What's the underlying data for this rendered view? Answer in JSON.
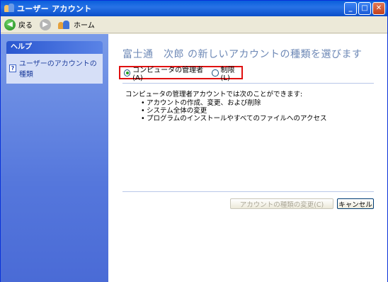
{
  "window": {
    "title": "ユーザー アカウント",
    "buttons": {
      "minimize": "_",
      "maximize": "□",
      "close": "✕"
    }
  },
  "toolbar": {
    "back_label": "戻る",
    "back_icon": "back-arrow-icon",
    "forward_icon": "forward-arrow-icon",
    "home_label": "ホーム",
    "home_icon": "users-icon"
  },
  "sidebar": {
    "help_title": "ヘルプ",
    "help_link": "ユーザーのアカウントの種類",
    "help_icon": "question-icon"
  },
  "main": {
    "heading": "富士通　次郎 の新しいアカウントの種類を選びます",
    "options": [
      {
        "label": "コンピュータの管理者(A)",
        "selected": true
      },
      {
        "label": "制限(L)",
        "selected": false
      }
    ],
    "description": "コンピュータの管理者アカウントでは次のことができます:",
    "bullets": [
      "アカウントの作成、変更、および削除",
      "システム全体の変更",
      "プログラムのインストールやすべてのファイルへのアクセス"
    ],
    "change_button": "アカウントの種類の変更(C)",
    "cancel_button": "キャンセル"
  },
  "colors": {
    "titlebar": "#0a5fdb",
    "sidebar": "#5577dc",
    "heading": "#6d88b6",
    "highlight": "#e01010"
  }
}
